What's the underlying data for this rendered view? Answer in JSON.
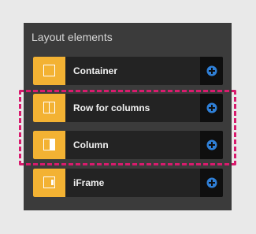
{
  "panel": {
    "title": "Layout elements",
    "items": [
      {
        "label": "Container",
        "icon": "container-icon"
      },
      {
        "label": "Row for columns",
        "icon": "row-columns-icon"
      },
      {
        "label": "Column",
        "icon": "column-icon"
      },
      {
        "label": "iFrame",
        "icon": "iframe-icon"
      }
    ],
    "add_icon": "plus-circle-icon"
  },
  "colors": {
    "panel_bg": "#3b3b3b",
    "item_bg": "#232323",
    "thumb_accent": "#f3b233",
    "add_bg": "#0f0f0f",
    "plus_blue": "#2f7fd6",
    "highlight_dash": "#d81b6d"
  }
}
